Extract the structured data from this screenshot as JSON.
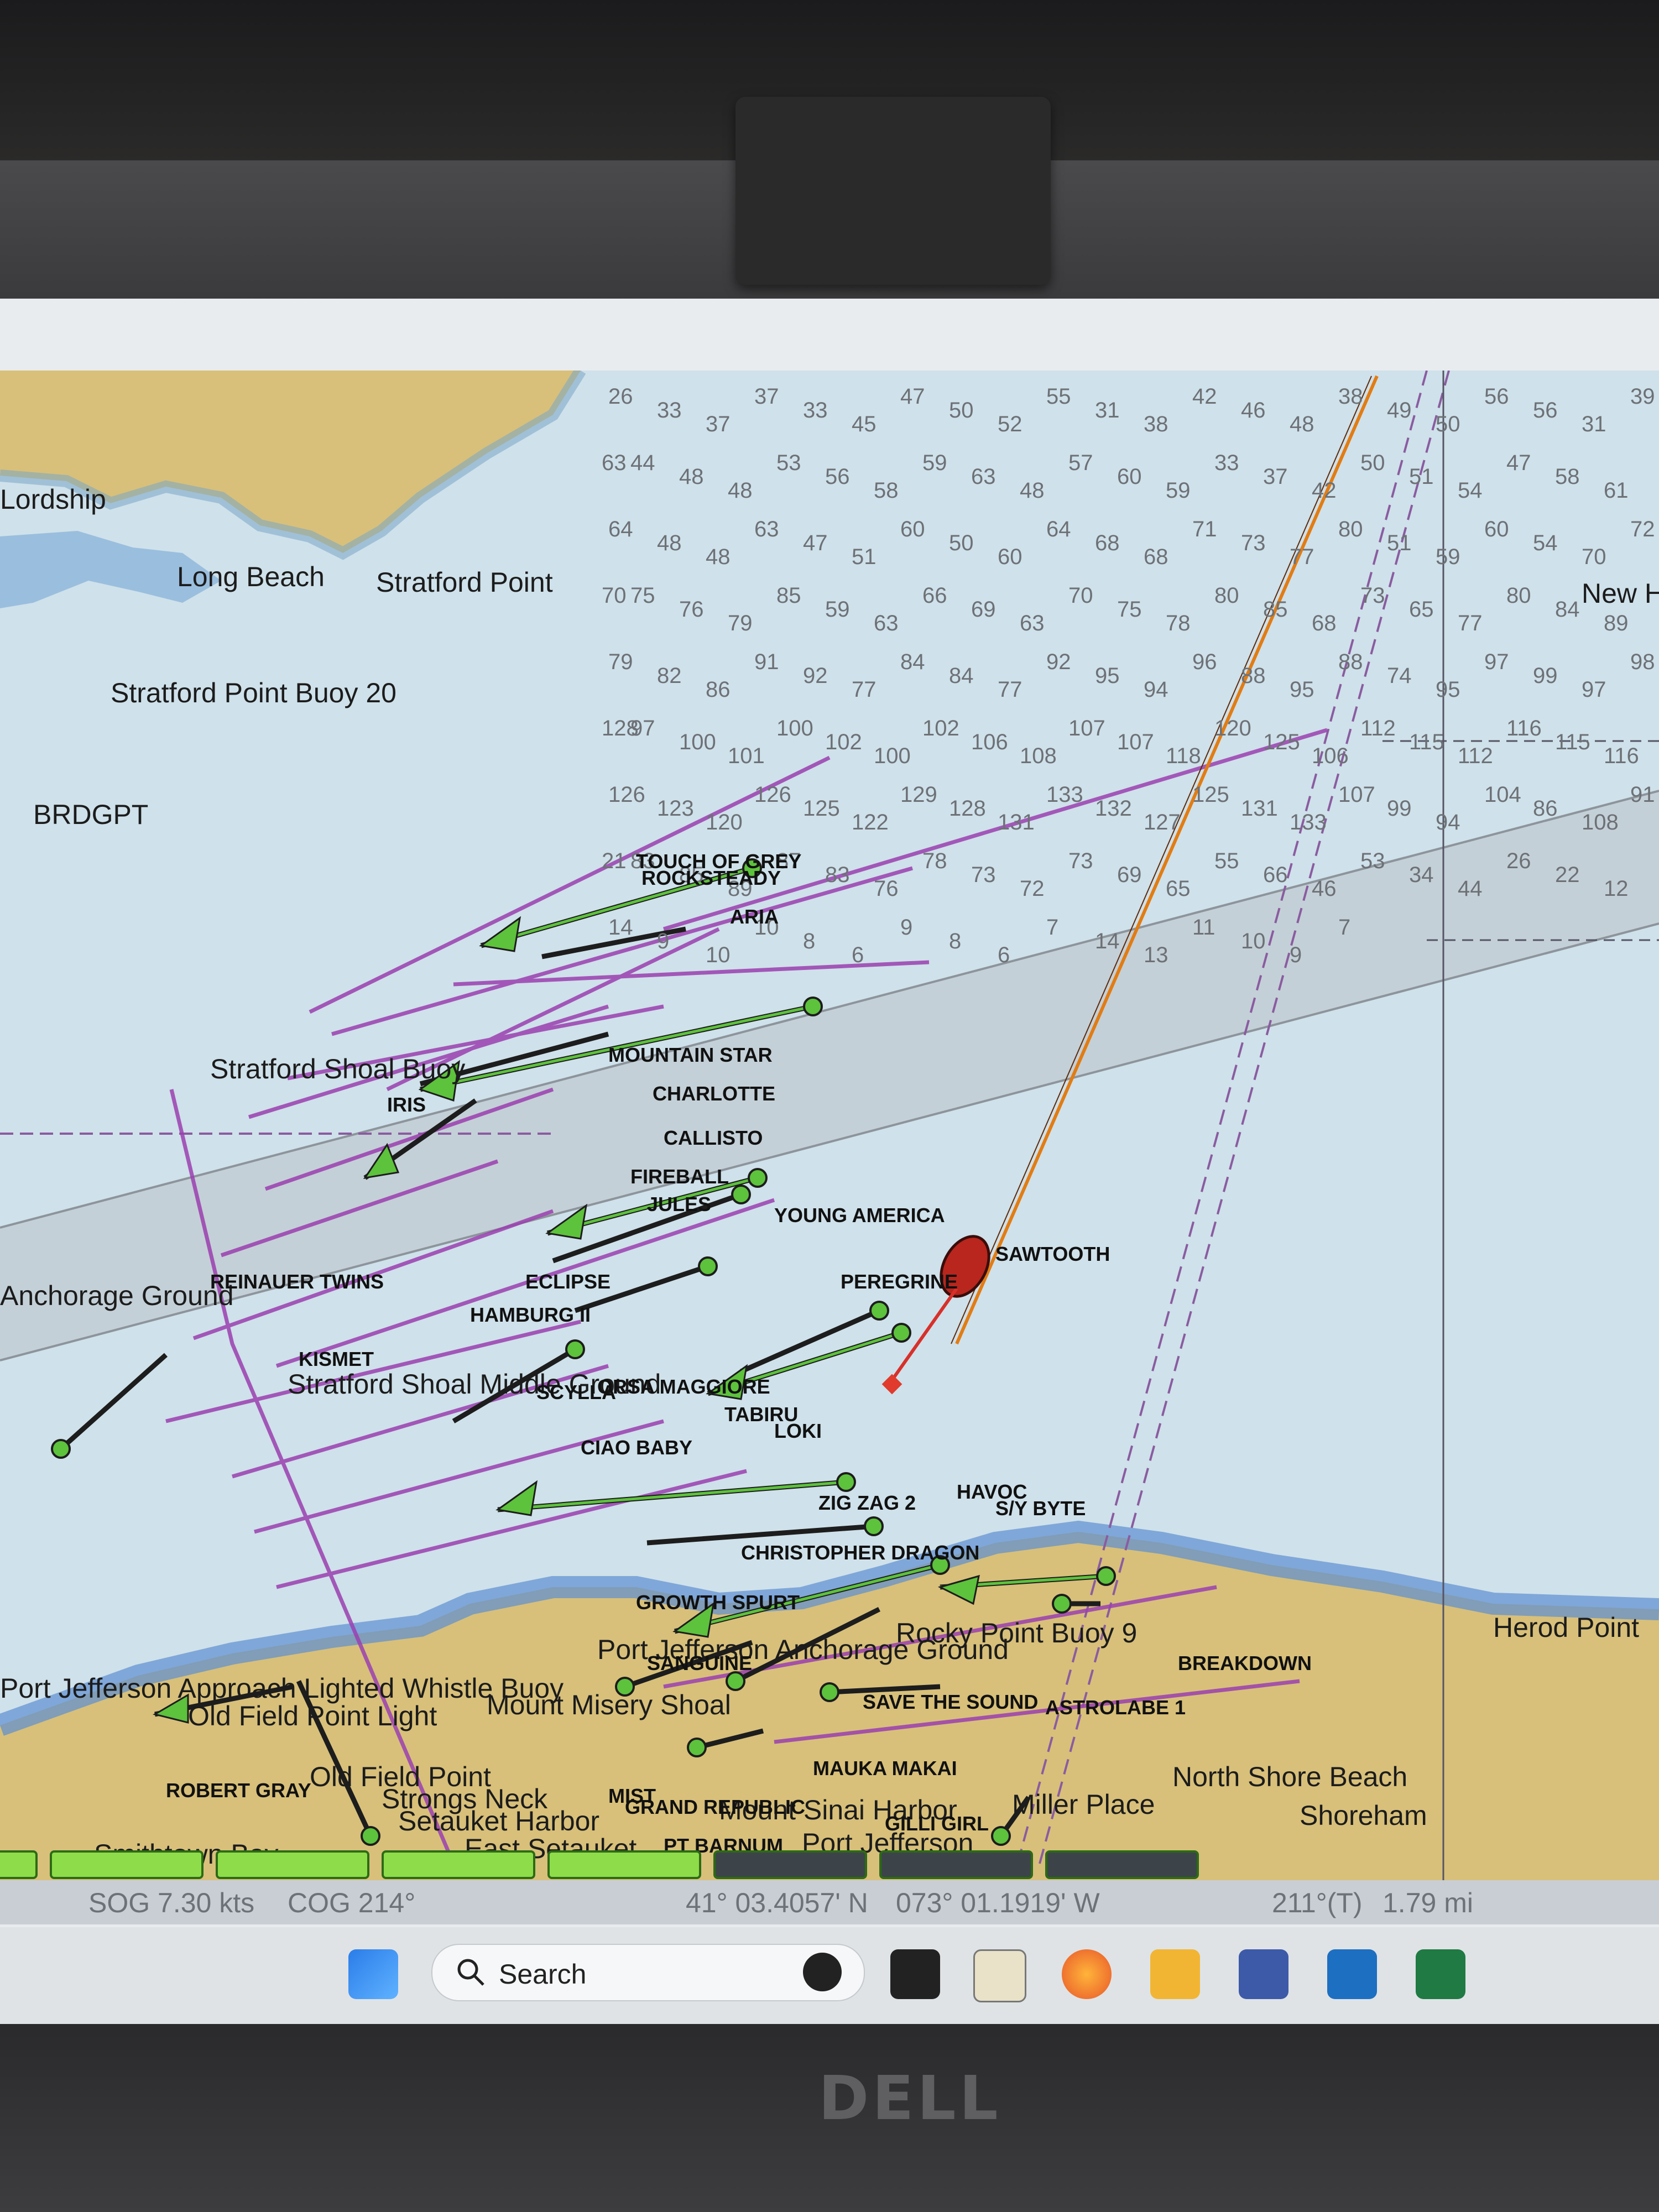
{
  "laptop": {
    "brand": "DELL"
  },
  "status": {
    "sog": "SOG 7.30 kts",
    "cog": "COG 214°",
    "lat": "41° 03.4057' N",
    "lon": "073° 01.1919' W",
    "bearing": "211°(T)",
    "range": "1.79 mi"
  },
  "taskbar": {
    "search_label": "Search"
  },
  "places": [
    "Long Beach",
    "Stratford Point",
    "Stratford Point Buoy 20",
    "Stratford Shoal Buoy",
    "Stratford Shoal Middle Ground",
    "Old Field Point Light",
    "Old Field Point",
    "Mount Misery Shoal",
    "Port Jefferson Anchorage Ground",
    "Port Jefferson",
    "Port Jefferson Approach Lighted Whistle Buoy",
    "Rocky Point Buoy 9",
    "Mount Sinai Harbor",
    "Miller Place",
    "North Shore Beach",
    "Shoreham",
    "Setauket Harbor",
    "East Setauket",
    "Strongs Neck",
    "Smithtown Bay",
    "Herod Point",
    "Anchorage Ground",
    "BRDGPT",
    "Lordship",
    "New Haven"
  ],
  "boats": [
    "ARIA",
    "ROCKSTEADY",
    "TOUCH OF GREY",
    "IRIS",
    "CHARLOTTE",
    "CALLISTO",
    "FIREBALL",
    "JULES",
    "YOUNG AMERICA",
    "SAWTOOTH",
    "PEREGRINE",
    "ECLIPSE",
    "HAMBURG II",
    "REINAUER TWINS",
    "KISMET",
    "SCYLLA",
    "ORSA MAGGIORE",
    "CIAO BABY",
    "TABIRU",
    "LOKI",
    "ZIG ZAG 2",
    "HAVOC",
    "S/Y BYTE",
    "CHRISTOPHER DRAGON",
    "GROWTH SPURT",
    "SANGUINE",
    "SAVE THE SOUND",
    "ASTROLABE 1",
    "MAUKA MAKAI",
    "GRAND REPUBLIC",
    "GILLI GIRL",
    "MIST",
    "PT BARNUM",
    "BREAKDOWN",
    "ROBERT GRAY",
    "MOUNTAIN STAR"
  ],
  "depths": [
    26,
    33,
    37,
    37,
    33,
    45,
    47,
    50,
    52,
    55,
    31,
    38,
    42,
    46,
    48,
    38,
    49,
    50,
    56,
    56,
    31,
    39,
    44,
    48,
    48,
    53,
    56,
    58,
    59,
    63,
    48,
    57,
    60,
    59,
    33,
    37,
    42,
    50,
    51,
    54,
    47,
    58,
    61,
    63,
    64,
    48,
    48,
    63,
    47,
    51,
    60,
    50,
    60,
    64,
    68,
    68,
    71,
    73,
    77,
    80,
    51,
    59,
    60,
    54,
    70,
    72,
    75,
    76,
    79,
    85,
    59,
    63,
    66,
    69,
    63,
    70,
    75,
    78,
    80,
    85,
    68,
    73,
    65,
    77,
    80,
    84,
    89,
    70,
    79,
    82,
    86,
    91,
    92,
    77,
    84,
    84,
    77,
    92,
    95,
    94,
    96,
    88,
    95,
    88,
    74,
    95,
    97,
    99,
    97,
    98,
    97,
    100,
    101,
    100,
    102,
    100,
    102,
    106,
    108,
    107,
    107,
    118,
    120,
    125,
    106,
    112,
    115,
    112,
    116,
    115,
    116,
    128,
    126,
    123,
    120,
    126,
    125,
    122,
    129,
    128,
    131,
    133,
    132,
    127,
    125,
    131,
    133,
    107,
    99,
    94,
    104,
    86,
    108,
    91,
    83,
    85,
    89,
    87,
    83,
    76,
    78,
    73,
    72,
    73,
    69,
    65,
    55,
    66,
    46,
    53,
    34,
    44,
    26,
    22,
    12,
    21,
    14,
    9,
    10,
    10,
    8,
    6,
    9,
    8,
    6,
    7,
    14,
    13,
    11,
    10,
    9,
    7
  ]
}
